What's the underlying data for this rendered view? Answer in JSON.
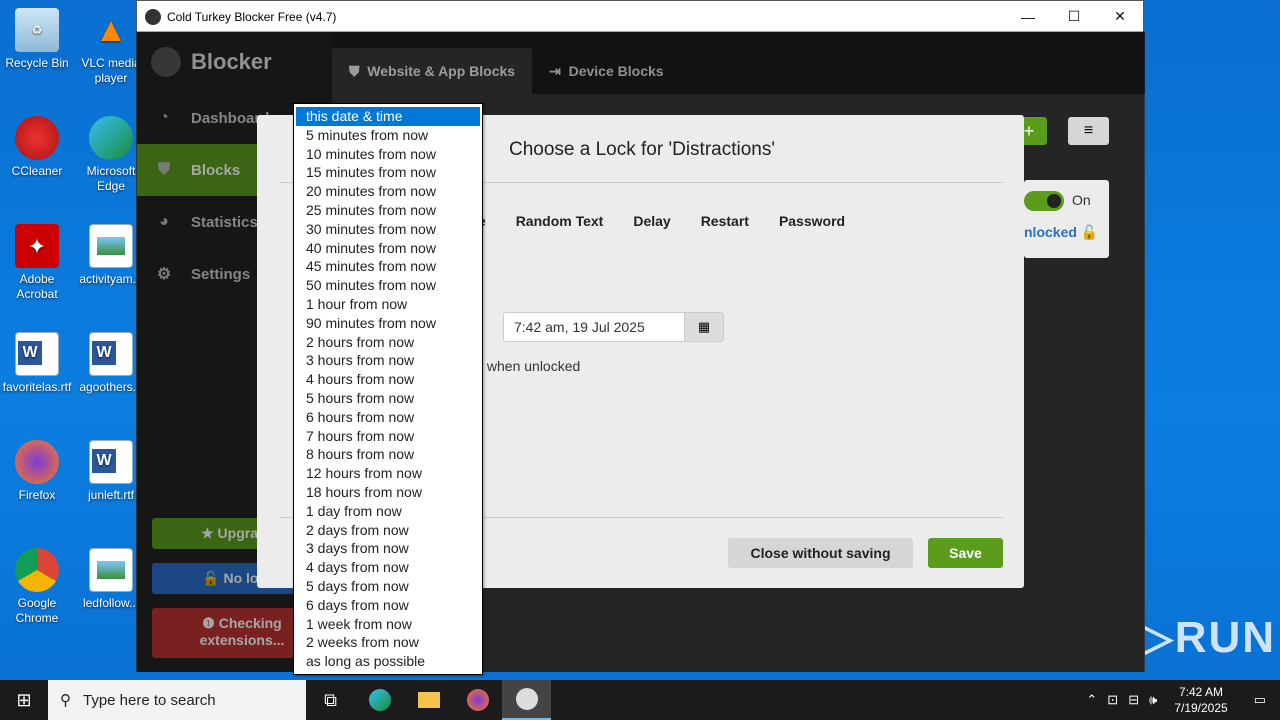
{
  "desktop_icons": [
    {
      "label": "Recycle Bin",
      "icon": "recycle-bin-icon"
    },
    {
      "label": "VLC media player",
      "icon": "vlc-icon"
    },
    {
      "label": "CCleaner",
      "icon": "ccleaner-icon"
    },
    {
      "label": "Microsoft Edge",
      "icon": "edge-icon"
    },
    {
      "label": "Adobe Acrobat",
      "icon": "acrobat-icon"
    },
    {
      "label": "activityam...",
      "icon": "image-file-icon"
    },
    {
      "label": "favoritelas.rtf",
      "icon": "word-file-icon"
    },
    {
      "label": "agoothers...",
      "icon": "word-file-icon"
    },
    {
      "label": "Firefox",
      "icon": "firefox-icon"
    },
    {
      "label": "junleft.rtf",
      "icon": "word-file-icon"
    },
    {
      "label": "Google Chrome",
      "icon": "chrome-icon"
    },
    {
      "label": "ledfollow...",
      "icon": "image-file-icon"
    }
  ],
  "window": {
    "title": "Cold Turkey Blocker Free (v4.7)",
    "minimize": "—",
    "maximize": "☐",
    "close": "✕"
  },
  "sidebar": {
    "brand": "Blocker",
    "items": [
      {
        "label": "Dashboard",
        "icon": "dashboard-icon"
      },
      {
        "label": "Blocks",
        "icon": "shield-icon"
      },
      {
        "label": "Statistics",
        "icon": "pie-chart-icon"
      },
      {
        "label": "Settings",
        "icon": "gear-icon"
      }
    ],
    "upgrade": "★ Upgrade t",
    "no_locks": "🔓 No locks",
    "checking": "❶ Checking extensions..."
  },
  "tabs": [
    {
      "label": "Website & App Blocks"
    },
    {
      "label": "Device Blocks"
    }
  ],
  "background": {
    "toggle_label": "On",
    "unlocked": "nlocked 🔓"
  },
  "modal": {
    "title": "Choose a Lock for 'Distractions'",
    "lock_types": [
      "ange",
      "Random Text",
      "Delay",
      "Restart",
      "Password"
    ],
    "date_value": "7:42 am, 19 Jul 2025",
    "unlock_text": "ck when unlocked",
    "close_button": "Close without saving",
    "save_button": "Save"
  },
  "dropdown": {
    "selected": "this date & time",
    "options": [
      "5 minutes from now",
      "10 minutes from now",
      "15 minutes from now",
      "20 minutes from now",
      "25 minutes from now",
      "30 minutes from now",
      "40 minutes from now",
      "45 minutes from now",
      "50 minutes from now",
      "1 hour from now",
      "90 minutes from now",
      "2 hours from now",
      "3 hours from now",
      "4 hours from now",
      "5 hours from now",
      "6 hours from now",
      "7 hours from now",
      "8 hours from now",
      "12 hours from now",
      "18 hours from now",
      "1 day from now",
      "2 days from now",
      "3 days from now",
      "4 days from now",
      "5 days from now",
      "6 days from now",
      "1 week from now",
      "2 weeks from now",
      "as long as possible"
    ]
  },
  "taskbar": {
    "search_placeholder": "Type here to search",
    "time": "7:42 AM",
    "date": "7/19/2025"
  },
  "watermark": "ANY▷RUN",
  "colors": {
    "accent_green": "#5a9c1c",
    "selection_blue": "#0078d7"
  }
}
